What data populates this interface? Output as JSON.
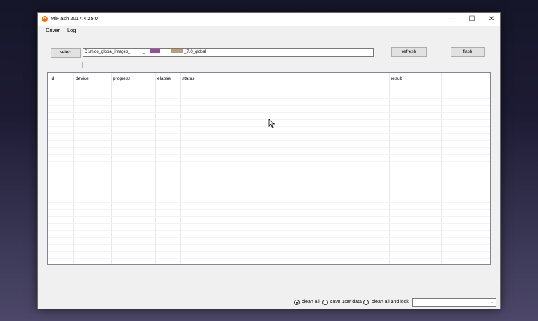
{
  "window": {
    "title": "MiFlash 2017.4.25.0",
    "app_icon_text": "mi",
    "minimize_glyph": "—",
    "maximize_glyph": "☐",
    "close_glyph": "✕"
  },
  "menu": {
    "items": [
      "Driver",
      "Log"
    ]
  },
  "toolbar": {
    "select_label": "select",
    "path_prefix": "D:\\mido_global_images_",
    "path_mid": "_",
    "path_suffix": "_7.0_global",
    "refresh_label": "refresh",
    "flash_label": "flash",
    "redaction_colors": [
      "#9b4aa0",
      "#b9a07a"
    ]
  },
  "table": {
    "columns": [
      "id",
      "device",
      "progress",
      "elapse",
      "status",
      "result"
    ],
    "rows": []
  },
  "statusbar": {
    "options": [
      {
        "label": "clean all",
        "checked": true
      },
      {
        "label": "save user data",
        "checked": false
      },
      {
        "label": "clean all and lock",
        "checked": false
      }
    ],
    "dropdown_value": ""
  }
}
